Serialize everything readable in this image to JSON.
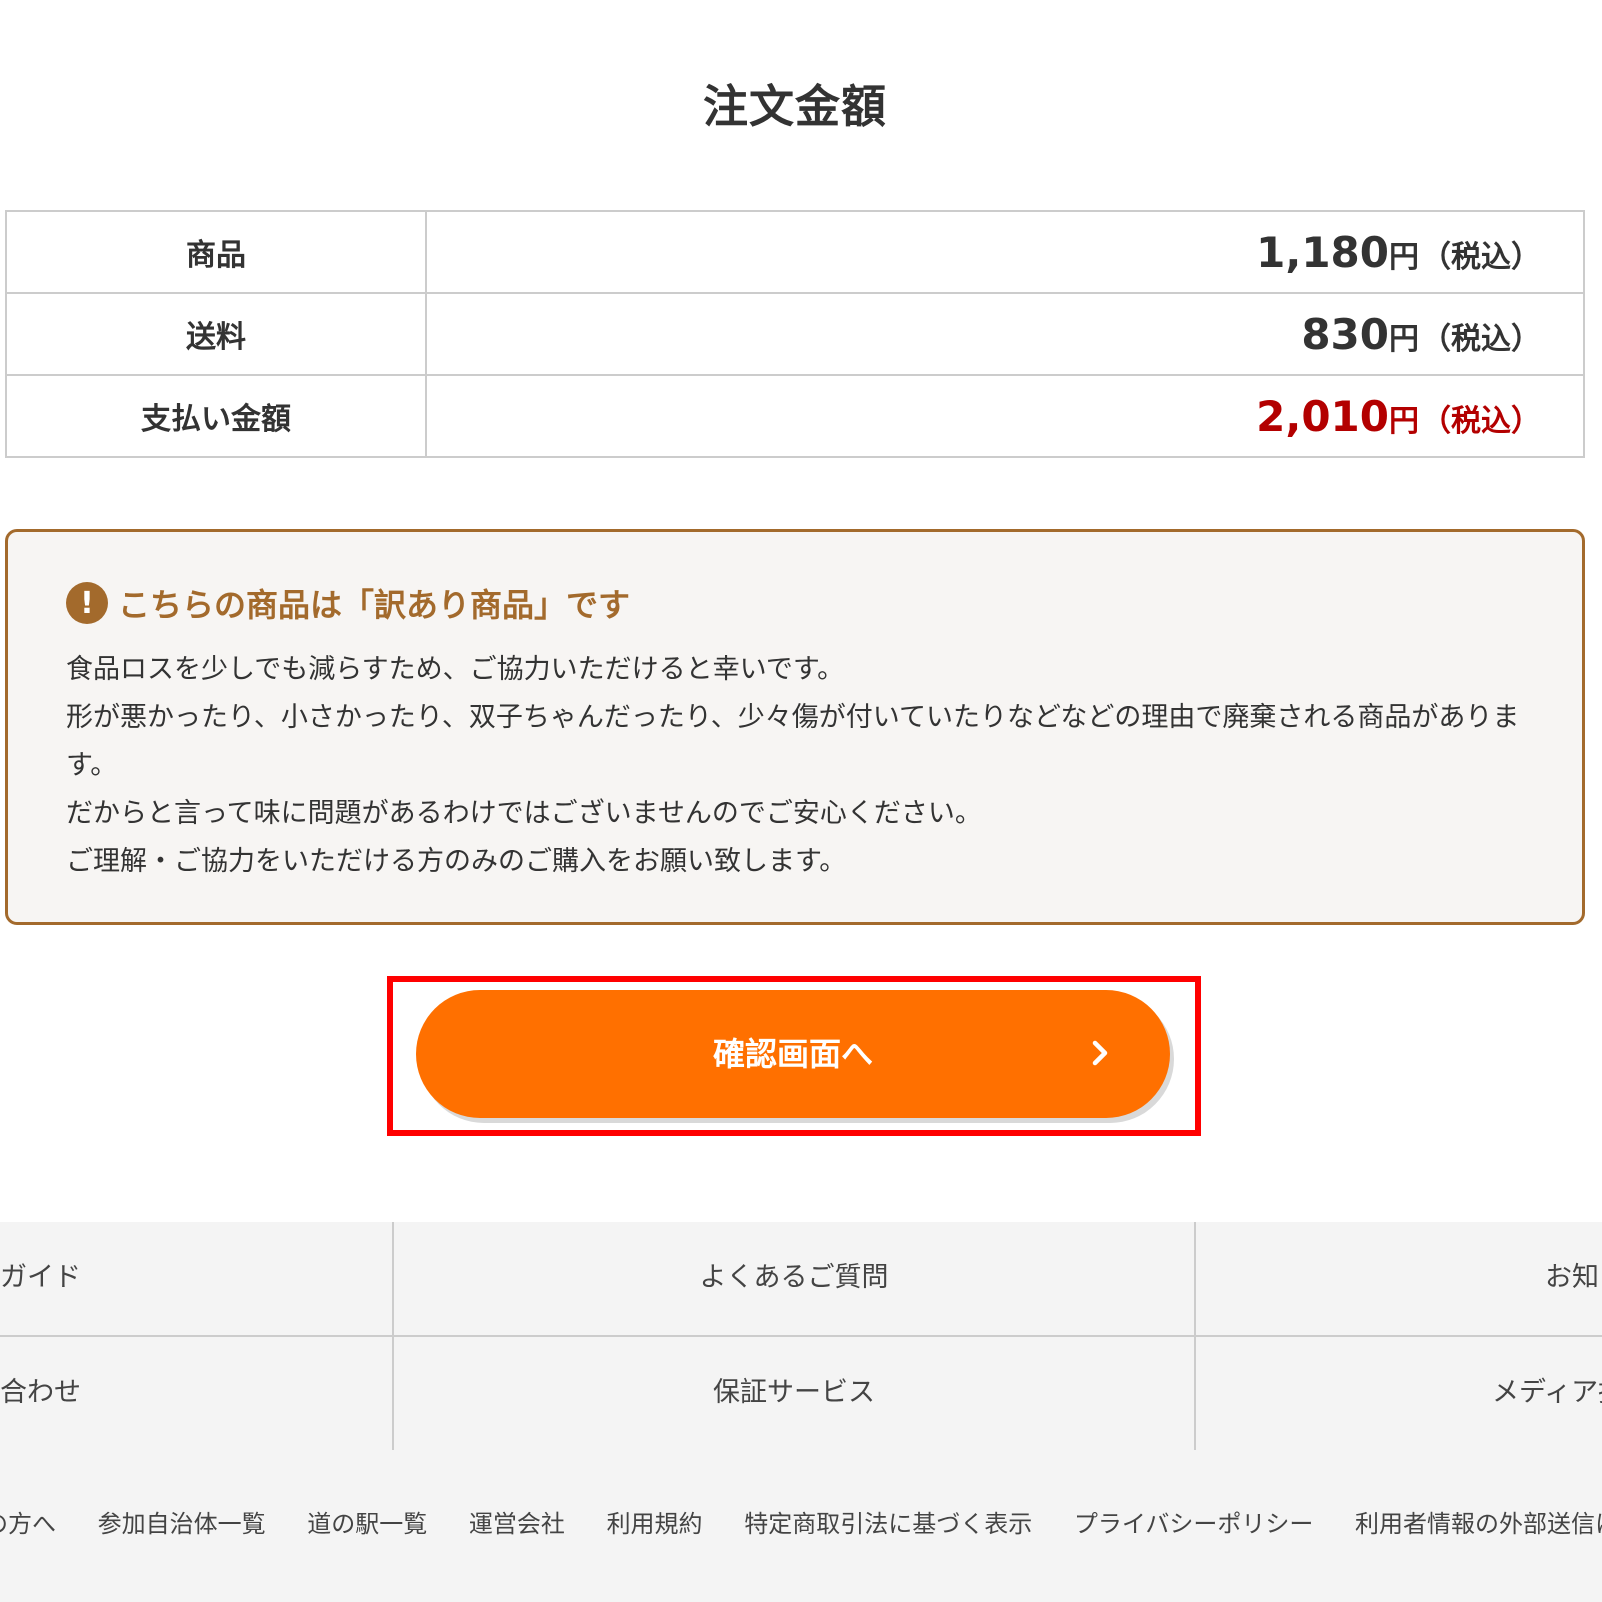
{
  "page_title": "注文金額",
  "price_table": {
    "rows": [
      {
        "label": "商品",
        "amount": "1,180",
        "yen": "円",
        "tax": "（税込）"
      },
      {
        "label": "送料",
        "amount": "830",
        "yen": "円",
        "tax": "（税込）"
      },
      {
        "label": "支払い金額",
        "amount": "2,010",
        "yen": "円",
        "tax": "（税込）"
      }
    ]
  },
  "notice": {
    "icon": "exclamation-circle-icon",
    "icon_glyph": "!",
    "heading": "こちらの商品は「訳あり商品」です",
    "lines": [
      "食品ロスを少しでも減らすため、ご協力いただけると幸いです。",
      "形が悪かったり、小さかったり、双子ちゃんだったり、少々傷が付いていたりなどなどの理由で廃棄される商品があります。",
      "だからと言って味に問題があるわけではございませんのでご安心ください。",
      "ご理解・ご協力をいただける方のみのご購入をお願い致します。"
    ],
    "accent_color": "#a36a2c"
  },
  "confirm_button": {
    "label": "確認画面へ",
    "icon": "chevron-right-icon",
    "color": "#ff7000",
    "highlight_color": "#ff0000"
  },
  "footer_nav": {
    "row1": [
      "ガイド",
      "よくあるご質問",
      "お知ら"
    ],
    "row2": [
      "合わせ",
      "保証サービス",
      "メディア掲"
    ]
  },
  "footer_links": [
    "者の方へ",
    "参加自治体一覧",
    "道の駅一覧",
    "運営会社",
    "利用規約",
    "特定商取引法に基づく表示",
    "プライバシーポリシー",
    "利用者情報の外部送信につ"
  ]
}
